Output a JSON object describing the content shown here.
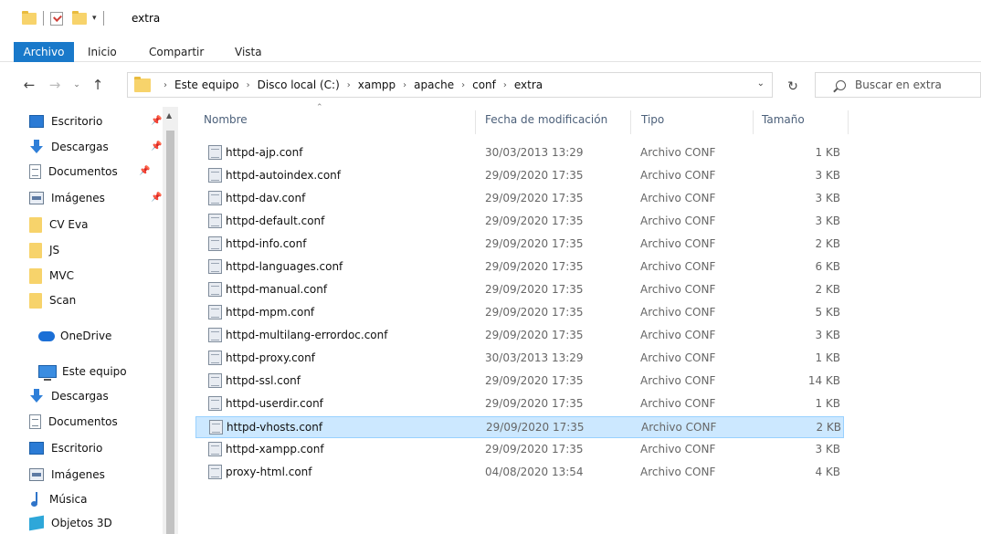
{
  "window": {
    "title": "extra",
    "qat_dropdown": "▾"
  },
  "ribbon": {
    "tabs": [
      "Archivo",
      "Inicio",
      "Compartir",
      "Vista"
    ]
  },
  "navigation": {
    "back": "←",
    "forward": "→",
    "history": "⌄",
    "up": "↑",
    "refresh": "↻",
    "address_dropdown": "⌄",
    "breadcrumb": [
      "Este equipo",
      "Disco local (C:)",
      "xampp",
      "apache",
      "conf",
      "extra"
    ],
    "crumb_separator": "›",
    "search_placeholder": "Buscar en extra"
  },
  "sidebar": {
    "quick_access": [
      {
        "label": "Escritorio",
        "icon": "desktop-icon",
        "pinned": true
      },
      {
        "label": "Descargas",
        "icon": "download-icon",
        "pinned": true
      },
      {
        "label": "Documentos",
        "icon": "documents-icon",
        "pinned": true
      },
      {
        "label": "Imágenes",
        "icon": "images-icon",
        "pinned": true
      },
      {
        "label": "CV Eva",
        "icon": "folder-icon",
        "pinned": false
      },
      {
        "label": "JS",
        "icon": "folder-icon",
        "pinned": false
      },
      {
        "label": "MVC",
        "icon": "folder-icon",
        "pinned": false
      },
      {
        "label": "Scan",
        "icon": "folder-icon",
        "pinned": false
      }
    ],
    "onedrive": {
      "label": "OneDrive",
      "icon": "onedrive-icon"
    },
    "this_pc": {
      "label": "Este equipo",
      "icon": "computer-icon"
    },
    "this_pc_items": [
      {
        "label": "Descargas",
        "icon": "download-icon"
      },
      {
        "label": "Documentos",
        "icon": "documents-icon"
      },
      {
        "label": "Escritorio",
        "icon": "desktop-icon"
      },
      {
        "label": "Imágenes",
        "icon": "images-icon"
      },
      {
        "label": "Música",
        "icon": "music-icon"
      },
      {
        "label": "Objetos 3D",
        "icon": "objects-3d-icon"
      }
    ],
    "pin_glyph": "📌"
  },
  "columns": {
    "name": "Nombre",
    "date": "Fecha de modificación",
    "type": "Tipo",
    "size": "Tamaño",
    "sort_indicator": "⌃"
  },
  "files": [
    {
      "name": "httpd-ajp.conf",
      "date": "30/03/2013 13:29",
      "type": "Archivo CONF",
      "size": "1 KB"
    },
    {
      "name": "httpd-autoindex.conf",
      "date": "29/09/2020 17:35",
      "type": "Archivo CONF",
      "size": "3 KB"
    },
    {
      "name": "httpd-dav.conf",
      "date": "29/09/2020 17:35",
      "type": "Archivo CONF",
      "size": "3 KB"
    },
    {
      "name": "httpd-default.conf",
      "date": "29/09/2020 17:35",
      "type": "Archivo CONF",
      "size": "3 KB"
    },
    {
      "name": "httpd-info.conf",
      "date": "29/09/2020 17:35",
      "type": "Archivo CONF",
      "size": "2 KB"
    },
    {
      "name": "httpd-languages.conf",
      "date": "29/09/2020 17:35",
      "type": "Archivo CONF",
      "size": "6 KB"
    },
    {
      "name": "httpd-manual.conf",
      "date": "29/09/2020 17:35",
      "type": "Archivo CONF",
      "size": "2 KB"
    },
    {
      "name": "httpd-mpm.conf",
      "date": "29/09/2020 17:35",
      "type": "Archivo CONF",
      "size": "5 KB"
    },
    {
      "name": "httpd-multilang-errordoc.conf",
      "date": "29/09/2020 17:35",
      "type": "Archivo CONF",
      "size": "3 KB"
    },
    {
      "name": "httpd-proxy.conf",
      "date": "30/03/2013 13:29",
      "type": "Archivo CONF",
      "size": "1 KB"
    },
    {
      "name": "httpd-ssl.conf",
      "date": "29/09/2020 17:35",
      "type": "Archivo CONF",
      "size": "14 KB"
    },
    {
      "name": "httpd-userdir.conf",
      "date": "29/09/2020 17:35",
      "type": "Archivo CONF",
      "size": "1 KB"
    },
    {
      "name": "httpd-vhosts.conf",
      "date": "29/09/2020 17:35",
      "type": "Archivo CONF",
      "size": "2 KB",
      "selected": true
    },
    {
      "name": "httpd-xampp.conf",
      "date": "29/09/2020 17:35",
      "type": "Archivo CONF",
      "size": "3 KB"
    },
    {
      "name": "proxy-html.conf",
      "date": "04/08/2020 13:54",
      "type": "Archivo CONF",
      "size": "4 KB"
    }
  ],
  "colors": {
    "accent": "#1979ca",
    "selection": "#cce8ff",
    "selection_border": "#99d1ff",
    "folder": "#f7d36b",
    "header_text": "#4c607a"
  }
}
